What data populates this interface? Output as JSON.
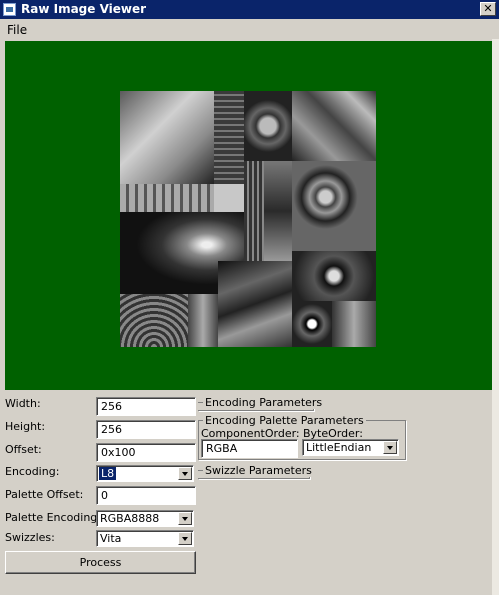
{
  "window": {
    "title": "Raw Image Viewer",
    "close_glyph": "✕"
  },
  "menu": {
    "file": "File"
  },
  "form": {
    "width_label": "Width:",
    "width_value": "256",
    "height_label": "Height:",
    "height_value": "256",
    "offset_label": "Offset:",
    "offset_value": "0x100",
    "encoding_label": "Encoding:",
    "encoding_value": "L8",
    "palette_offset_label": "Palette Offset:",
    "palette_offset_value": "0",
    "palette_encoding_label": "Palette Encoding:",
    "palette_encoding_value": "RGBA8888",
    "swizzles_label": "Swizzles:",
    "swizzles_value": "Vita",
    "process_button": "Process"
  },
  "groups": {
    "encoding_params": "Encoding Parameters",
    "encoding_palette_params": "Encoding Palette Parameters",
    "component_order_label": "ComponentOrder:",
    "component_order_value": "RGBA",
    "byte_order_label": "ByteOrder:",
    "byte_order_value": "LittleEndian",
    "swizzle_params": "Swizzle Parameters"
  },
  "colors": {
    "preview_bg": "#006100",
    "titlebar": "#0a246a",
    "window_bg": "#d4d0c8"
  },
  "icons": {
    "app": "window-icon",
    "close": "close-icon",
    "dropdown": "chevron-down-icon"
  }
}
